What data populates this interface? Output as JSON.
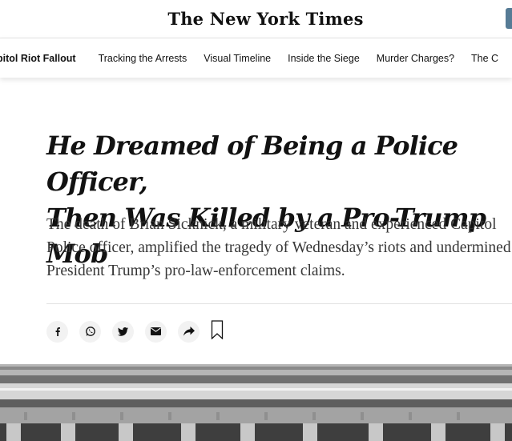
{
  "masthead": {
    "logo_text": "The New York Times"
  },
  "nav": {
    "lead_label": "pitol Riot Fallout",
    "items": [
      {
        "label": "Tracking the Arrests"
      },
      {
        "label": "Visual Timeline"
      },
      {
        "label": "Inside the Siege"
      },
      {
        "label": "Murder Charges?"
      },
      {
        "label": "The C"
      }
    ]
  },
  "article": {
    "headline_line1": "He Dreamed of Being a Police Officer,",
    "headline_line2": "Then Was Killed by a Pro-Trump Mob",
    "summary": "The death of Brian Sicknick, a military veteran and experienced Capitol Police officer, amplified the tragedy of Wednesday’s riots and undermined President Trump’s pro-law-enforcement claims."
  },
  "share": {
    "icons": [
      "facebook-icon",
      "whatsapp-icon",
      "twitter-icon",
      "email-icon",
      "share-arrow-icon",
      "bookmark-icon"
    ]
  },
  "colors": {
    "text": "#121212",
    "summary_text": "#363636",
    "share_bg": "#f2f2f2",
    "corner_button": "#567b95"
  }
}
